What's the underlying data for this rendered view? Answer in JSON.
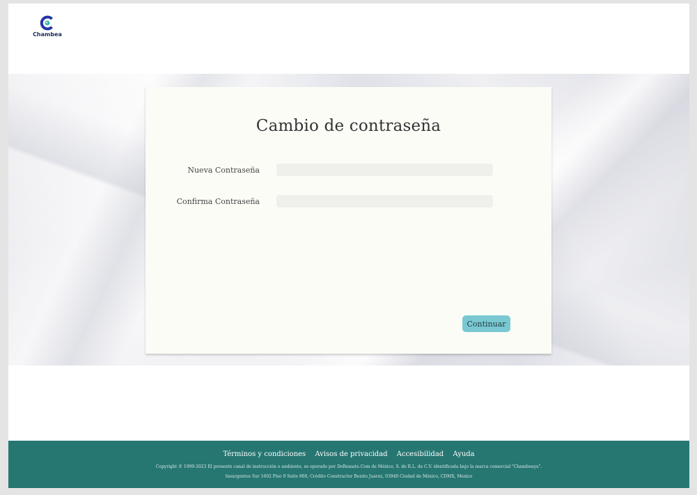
{
  "header": {
    "logo_text": "Chambea",
    "logo_color": "#1c2a5c",
    "logo_accent": "#2bb7a9"
  },
  "form": {
    "title": "Cambio de contraseña",
    "new_password_label": "Nueva Contraseña",
    "new_password_value": "",
    "confirm_password_label": "Confirma Contraseña",
    "confirm_password_value": "",
    "submit_label": "Continuar",
    "button_color": "#7ac9d2"
  },
  "footer": {
    "links": [
      "Términos y condiciones",
      "Avisos de privacidad",
      "Accesibilidad",
      "Ayuda"
    ],
    "copyright": "Copyright © 1999-2023 El presente canal de instrucción o ambiente, es operado por DeRemate.Com de México, S. de R.L. de C.V. identificada bajo la marca comercial \"Chambeaya\".",
    "address": "Insurgentes Sur 1602 Piso 9 Suite 900, Crédito Constructor Benito Juarez, 03940 Ciudad de México, CDMX, Mexico",
    "background_color": "#267672"
  }
}
